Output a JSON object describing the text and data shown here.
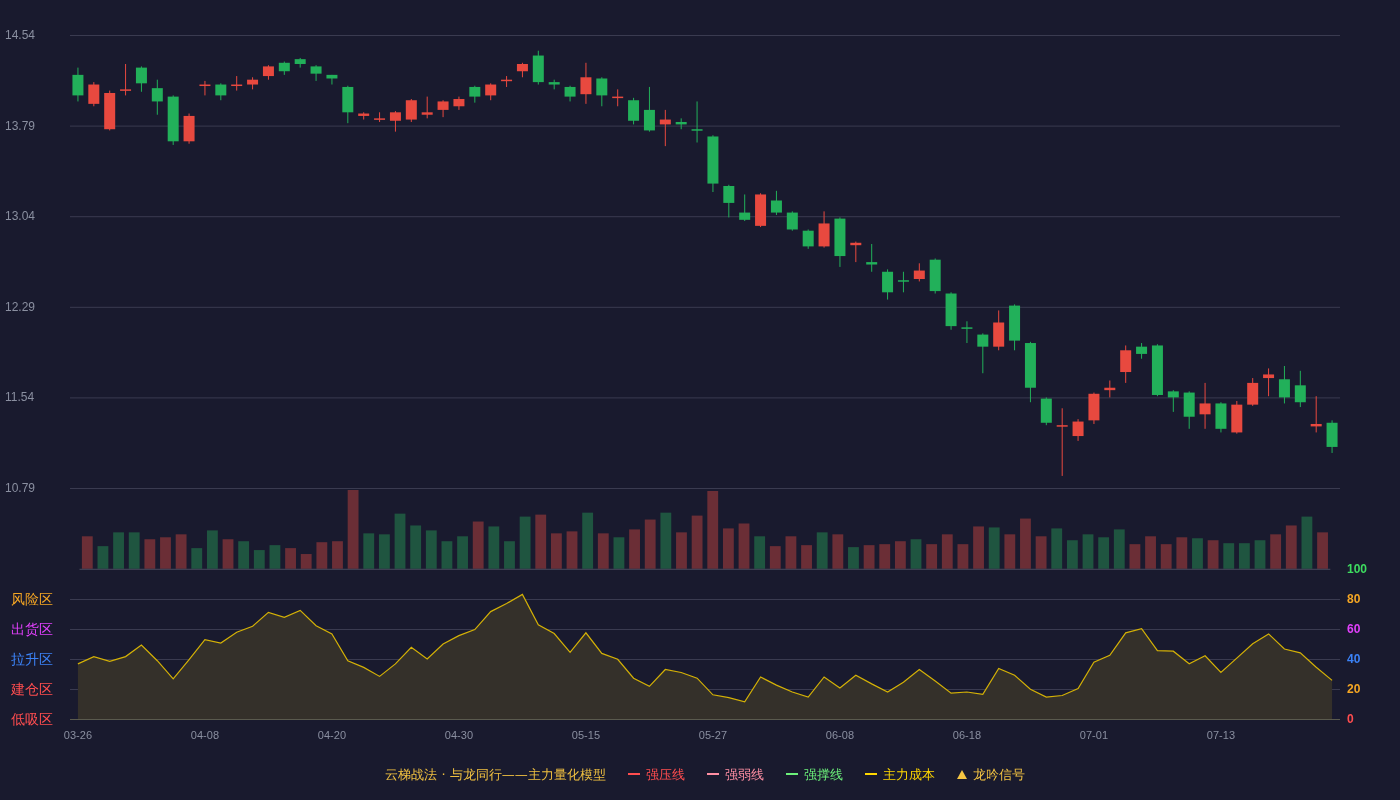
{
  "price_chart": {
    "chart_data": {
      "type": "candlestick",
      "ylim": [
        10.79,
        14.54
      ],
      "yticks": [
        14.54,
        13.79,
        13.04,
        12.29,
        11.54,
        10.79
      ],
      "grid": true,
      "ohlc": [
        [
          14.21,
          14.27,
          13.99,
          14.04
        ],
        [
          13.97,
          14.15,
          13.95,
          14.13
        ],
        [
          13.76,
          14.08,
          13.75,
          14.06
        ],
        [
          14.08,
          14.3,
          14.04,
          14.09
        ],
        [
          14.27,
          14.28,
          14.07,
          14.14
        ],
        [
          14.1,
          14.17,
          13.88,
          13.99
        ],
        [
          14.03,
          14.04,
          13.63,
          13.66
        ],
        [
          13.66,
          13.89,
          13.64,
          13.87
        ],
        [
          14.12,
          14.16,
          14.04,
          14.13
        ],
        [
          14.13,
          14.14,
          14.0,
          14.04
        ],
        [
          14.12,
          14.2,
          14.08,
          14.13
        ],
        [
          14.13,
          14.19,
          14.09,
          14.17
        ],
        [
          14.2,
          14.29,
          14.17,
          14.28
        ],
        [
          14.31,
          14.32,
          14.21,
          14.24
        ],
        [
          14.34,
          14.35,
          14.27,
          14.3
        ],
        [
          14.28,
          14.29,
          14.16,
          14.22
        ],
        [
          14.21,
          14.21,
          14.13,
          14.18
        ],
        [
          14.11,
          14.12,
          13.81,
          13.9
        ],
        [
          13.87,
          13.9,
          13.84,
          13.89
        ],
        [
          13.84,
          13.9,
          13.82,
          13.85
        ],
        [
          13.83,
          13.91,
          13.74,
          13.9
        ],
        [
          13.84,
          14.01,
          13.82,
          14.0
        ],
        [
          13.88,
          14.03,
          13.85,
          13.9
        ],
        [
          13.92,
          14.0,
          13.86,
          13.99
        ],
        [
          13.95,
          14.03,
          13.92,
          14.01
        ],
        [
          14.11,
          14.12,
          13.98,
          14.03
        ],
        [
          14.04,
          14.14,
          14.0,
          14.13
        ],
        [
          14.16,
          14.2,
          14.11,
          14.17
        ],
        [
          14.24,
          14.31,
          14.19,
          14.3
        ],
        [
          14.37,
          14.41,
          14.13,
          14.15
        ],
        [
          14.15,
          14.17,
          14.09,
          14.13
        ],
        [
          14.11,
          14.12,
          13.99,
          14.03
        ],
        [
          14.05,
          14.31,
          13.97,
          14.19
        ],
        [
          14.18,
          14.19,
          13.95,
          14.04
        ],
        [
          14.02,
          14.09,
          13.95,
          14.03
        ],
        [
          14.0,
          14.02,
          13.8,
          13.83
        ],
        [
          13.92,
          14.11,
          13.74,
          13.75
        ],
        [
          13.8,
          13.92,
          13.62,
          13.84
        ],
        [
          13.82,
          13.85,
          13.76,
          13.8
        ],
        [
          13.76,
          13.99,
          13.65,
          13.75
        ],
        [
          13.7,
          13.71,
          13.24,
          13.31
        ],
        [
          13.29,
          13.3,
          13.03,
          13.15
        ],
        [
          13.07,
          13.22,
          13.0,
          13.01
        ],
        [
          12.96,
          13.23,
          12.95,
          13.22
        ],
        [
          13.17,
          13.25,
          13.05,
          13.07
        ],
        [
          13.07,
          13.08,
          12.92,
          12.93
        ],
        [
          12.92,
          12.93,
          12.77,
          12.79
        ],
        [
          12.79,
          13.08,
          12.78,
          12.98
        ],
        [
          13.02,
          13.03,
          12.62,
          12.71
        ],
        [
          12.8,
          12.83,
          12.66,
          12.82
        ],
        [
          12.66,
          12.81,
          12.58,
          12.64
        ],
        [
          12.58,
          12.6,
          12.35,
          12.41
        ],
        [
          12.51,
          12.58,
          12.41,
          12.5
        ],
        [
          12.52,
          12.65,
          12.5,
          12.59
        ],
        [
          12.68,
          12.69,
          12.4,
          12.42
        ],
        [
          12.4,
          12.41,
          12.1,
          12.13
        ],
        [
          12.12,
          12.17,
          11.99,
          12.11
        ],
        [
          12.06,
          12.07,
          11.74,
          11.96
        ],
        [
          11.96,
          12.26,
          11.93,
          12.16
        ],
        [
          12.3,
          12.31,
          11.93,
          12.01
        ],
        [
          11.99,
          12.0,
          11.5,
          11.62
        ],
        [
          11.53,
          11.54,
          11.31,
          11.33
        ],
        [
          11.3,
          11.45,
          10.89,
          11.31
        ],
        [
          11.22,
          11.36,
          11.18,
          11.34
        ],
        [
          11.35,
          11.58,
          11.32,
          11.57
        ],
        [
          11.6,
          11.68,
          11.54,
          11.62
        ],
        [
          11.75,
          11.97,
          11.66,
          11.93
        ],
        [
          11.96,
          11.99,
          11.86,
          11.9
        ],
        [
          11.97,
          11.98,
          11.55,
          11.56
        ],
        [
          11.59,
          11.6,
          11.42,
          11.54
        ],
        [
          11.58,
          11.59,
          11.28,
          11.38
        ],
        [
          11.4,
          11.66,
          11.28,
          11.49
        ],
        [
          11.49,
          11.5,
          11.25,
          11.28
        ],
        [
          11.25,
          11.51,
          11.24,
          11.48
        ],
        [
          11.48,
          11.7,
          11.47,
          11.66
        ],
        [
          11.7,
          11.78,
          11.55,
          11.73
        ],
        [
          11.69,
          11.8,
          11.49,
          11.54
        ],
        [
          11.64,
          11.76,
          11.46,
          11.5
        ],
        [
          11.3,
          11.55,
          11.25,
          11.32
        ],
        [
          11.33,
          11.35,
          11.08,
          11.13
        ]
      ]
    }
  },
  "oscillator": {
    "zones": [
      {
        "label": "风险区",
        "color": "#f5a623"
      },
      {
        "label": "出货区",
        "color": "#e040fb"
      },
      {
        "label": "拉升区",
        "color": "#3b82f6"
      },
      {
        "label": "建仓区",
        "color": "#ff4d4f"
      },
      {
        "label": "低吸区",
        "color": "#ff4d4f"
      }
    ],
    "ytick_styles": [
      {
        "color": "#3ddc5f"
      },
      {
        "color": "#f5a623"
      },
      {
        "color": "#e040fb"
      },
      {
        "color": "#3b82f6"
      },
      {
        "color": "#f5a623"
      },
      {
        "color": "#ff4d4f"
      }
    ],
    "chart_data": {
      "type": "area",
      "ylim": [
        0,
        100
      ],
      "grid": true,
      "yticks": [
        100,
        80,
        60,
        40,
        20,
        0
      ],
      "categories": [
        "03-26",
        null,
        null,
        null,
        null,
        null,
        null,
        null,
        "04-08",
        null,
        null,
        null,
        null,
        null,
        null,
        null,
        "04-20",
        null,
        null,
        null,
        null,
        null,
        null,
        null,
        "04-30",
        null,
        null,
        null,
        null,
        null,
        null,
        null,
        "05-15",
        null,
        null,
        null,
        null,
        null,
        null,
        null,
        "05-27",
        null,
        null,
        null,
        null,
        null,
        null,
        null,
        "06-08",
        null,
        null,
        null,
        null,
        null,
        null,
        null,
        "06-18",
        null,
        null,
        null,
        null,
        null,
        null,
        null,
        "07-01",
        null,
        null,
        null,
        null,
        null,
        null,
        null,
        "07-13",
        null,
        null,
        null,
        null,
        null,
        null,
        null
      ],
      "series": [
        {
          "color": "#d4b106",
          "values": [
            36.7,
            41.6,
            38.4,
            41.6,
            49.3,
            38.9,
            26.7,
            39.6,
            52.9,
            50.7,
            57.8,
            61.8,
            71.1,
            67.8,
            72.4,
            62.2,
            56.7,
            38.9,
            34.4,
            28.4,
            36.7,
            47.8,
            40,
            50,
            55.6,
            59.6,
            71.6,
            77,
            83.1,
            62.8,
            57,
            44.4,
            57.5,
            43.7,
            39.8,
            27.2,
            21.8,
            33,
            31,
            27.2,
            16.1,
            14.2,
            11.5,
            28,
            22.6,
            18,
            14.6,
            28,
            20.7,
            29.1,
            23.4,
            18,
            24.5,
            33,
            25.3,
            17.2,
            18,
            16.5,
            33.7,
            29.1,
            19.9,
            14.6,
            15.7,
            20.3,
            37.9,
            42.5,
            57.5,
            60.2,
            45.6,
            45.2,
            36.8,
            42.1,
            31,
            40.6,
            50.2,
            56.7,
            46.7,
            44.1,
            34.5,
            25.7
          ]
        }
      ]
    }
  },
  "legend": {
    "title": "云梯战法 · 与龙同行——主力量化模型",
    "items": [
      {
        "label": "强压线",
        "kind": "solid",
        "color": "#ff4d4f"
      },
      {
        "label": "强弱线",
        "kind": "dashed",
        "color": "#ff8fa3"
      },
      {
        "label": "强撑线",
        "kind": "solid",
        "color": "#6cf07a"
      },
      {
        "label": "主力成本",
        "kind": "dashed",
        "color": "#ffd700"
      },
      {
        "label": "龙吟信号",
        "kind": "triangle",
        "color": "#f5c542"
      }
    ]
  }
}
